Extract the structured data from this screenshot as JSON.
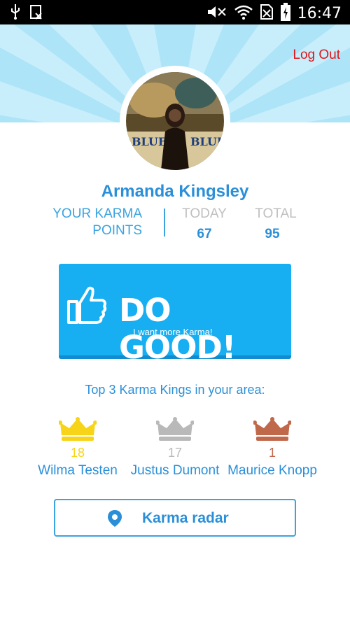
{
  "status_bar": {
    "time": "16:47",
    "icons": [
      "usb-icon",
      "screenshot-icon",
      "mute-icon",
      "wifi-icon",
      "no-sim-icon",
      "battery-icon"
    ]
  },
  "header": {
    "logout_label": "Log Out"
  },
  "profile": {
    "name": "Armanda Kingsley"
  },
  "karma": {
    "label_line1": "YOUR KARMA",
    "label_line2": "POINTS",
    "today_label": "TODAY",
    "today_value": "67",
    "total_label": "TOTAL",
    "total_value": "95"
  },
  "dogood": {
    "title": "DO GOOD!",
    "subtitle": "I want more Karma!"
  },
  "kings": {
    "title": "Top 3 Karma Kings in your area:",
    "list": [
      {
        "count": "18",
        "name": "Wilma Testen",
        "color": "#f7d417"
      },
      {
        "count": "17",
        "name": "Justus Dumont",
        "color": "#b9b9b9"
      },
      {
        "count": "1",
        "name": "Maurice Knopp",
        "color": "#c0684a"
      }
    ]
  },
  "radar": {
    "label": "Karma radar"
  },
  "colors": {
    "accent": "#2a8fd8",
    "button": "#17aef2",
    "logout": "#e0161a"
  }
}
